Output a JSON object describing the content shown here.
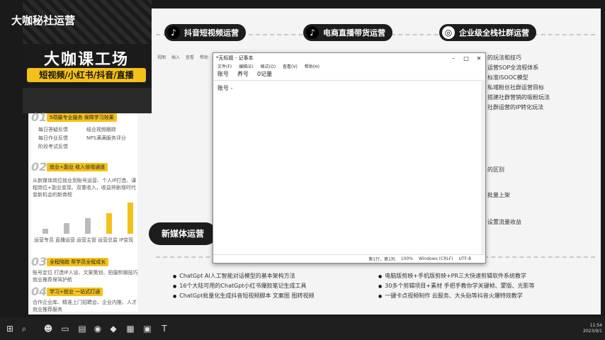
{
  "watermark": "大咖秘社运营",
  "columns": [
    {
      "label": "抖音短视频运营"
    },
    {
      "label": "电商直播带货运营"
    },
    {
      "label": "企业级全栈社群运营"
    }
  ],
  "promo": {
    "title": "大咖课工场",
    "tags": "短视频/小红书/抖音/直播"
  },
  "left_panel": {
    "sec1_title": "01",
    "sec1_tag": "5项最专业服务 保障学习效果",
    "sec1_items": [
      "每日答疑反馈",
      "每日作业反馈",
      "阶段考试反馈",
      "结业视频跟踪",
      "NPS满满服务评分"
    ],
    "sec2_title": "02",
    "sec2_tag": "就业+副业 收入倍增通道",
    "sec2_text": [
      "从新媒体岗位就业到账号运营、个人IP打造、课",
      "程岗位+副业变现、双重收入，收益将剧增时代",
      "变新机会的新商榜"
    ],
    "bar_labels": [
      "运营专员",
      "直播运营",
      "运营主管",
      "运营总监",
      "IP变现"
    ],
    "bar_values": [
      1,
      2,
      3,
      4,
      6
    ],
    "sec3_title": "03",
    "sec3_tag": "全程陪跑 帮学员全程成长",
    "sec3_text": [
      "账号定位 打造IP人设、文案策划、拍摄剪辑技巧",
      "就业推荐保驾护航"
    ],
    "sec4_title": "04",
    "sec4_tag": "学习+就业 一站式打通",
    "sec4_text": [
      "合作企业库、精准上门招聘会、企业内推、人才",
      "就业推荐服务"
    ]
  },
  "right_items": [
    "的玩法和技巧",
    "运营SOP全流程体系",
    "标准ISOOC模型",
    "私域粉丝社群运营目标",
    "搭建社群营销的吸粉玩法",
    "社群运营的IP转化玩法",
    "的区别",
    "批量上架",
    "设置流量收益"
  ],
  "bottom_left": [
    "ChatGpt AI人工智能对话模型的基本架构方法",
    "16个大陆可用的ChatGpt小红书爆款笔记生成工具",
    "ChatGpt批量化生成抖音短视频脚本 文案图 图转视频"
  ],
  "bottom_right": [
    "电脑版剪映+手机版剪映+PR三大快速剪辑软件系统教学",
    "30多个剪辑项目+素材 手把手教你学关键帧、蒙版、光影等",
    "一键卡点视频制作 云服务、大头贴等抖音火爆特效教学"
  ],
  "pill_label": "新媒体运营",
  "notepad": {
    "title": "*无标题 - 记事本",
    "menu": [
      "文件(F)",
      "编辑(E)",
      "格式(O)",
      "查看(V)",
      "帮助(H)"
    ],
    "tabs": [
      "账号",
      "养号",
      "0记量"
    ],
    "content": "账号 -",
    "status": [
      "第1行，第1列",
      "100%",
      "Windows (CRLF)",
      "UTF-8"
    ],
    "ghost_left": [
      "视图",
      "插入",
      "查看",
      "帮助"
    ],
    "ghost_right": [
      "显示",
      "隐藏"
    ]
  },
  "clock": {
    "time": "11:54",
    "date": "2023/9/1"
  },
  "colors": {
    "accent": "#f3c11a",
    "dark": "#1d1d1d"
  }
}
